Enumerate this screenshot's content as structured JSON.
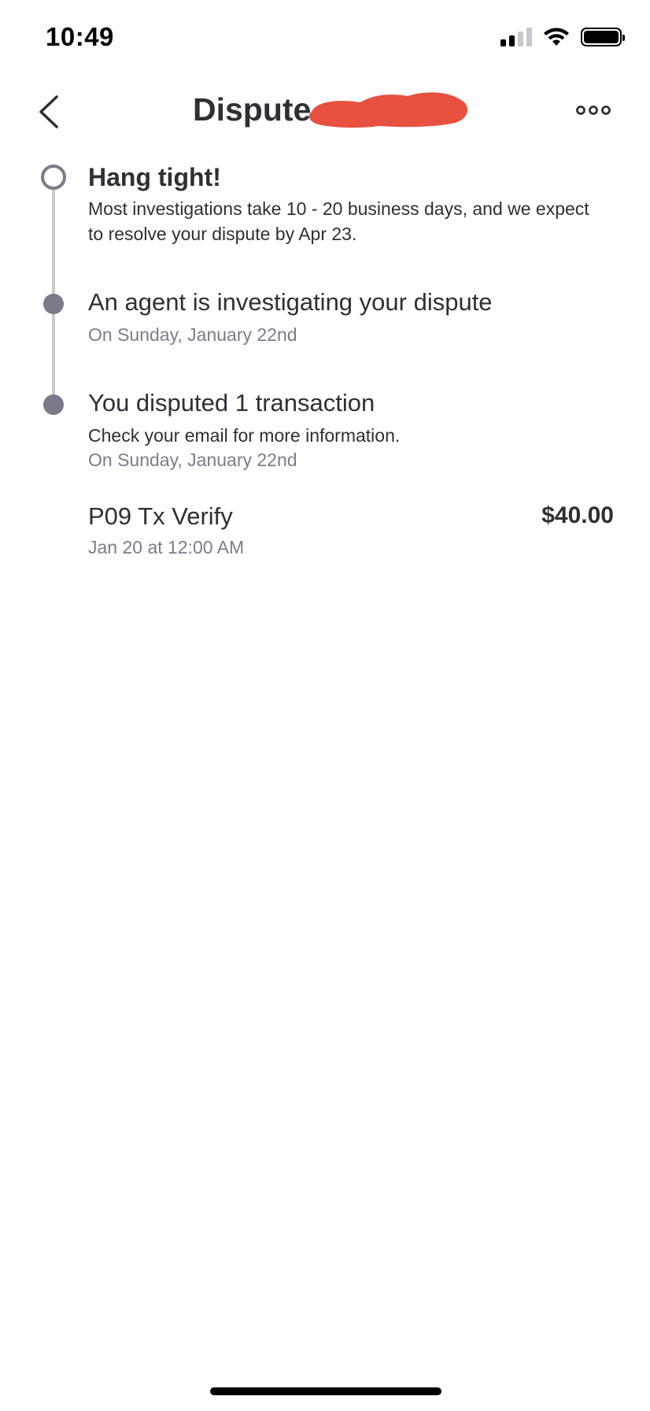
{
  "status_bar": {
    "time": "10:49",
    "icons": [
      "signal-icon",
      "wifi-icon",
      "battery-icon"
    ]
  },
  "nav": {
    "title": "Dispute",
    "back_icon": "chevron-left-icon",
    "more_icon": "more-horizontal-icon",
    "redaction_color": "#e8503f"
  },
  "timeline": {
    "current": {
      "title": "Hang tight!",
      "body_line1": "Most investigations take 10 - 20 business days, and we expect",
      "body_line2": "to resolve your dispute by Apr 23."
    },
    "events": [
      {
        "title": "An agent is investigating your dispute",
        "date": "On Sunday, January 22nd"
      },
      {
        "title": "You disputed 1 transaction",
        "detail": "Check your email for more information.",
        "date": "On Sunday, January 22nd"
      }
    ]
  },
  "transaction": {
    "name": "P09 Tx Verify",
    "amount": "$40.00",
    "date": "Jan 20 at 12:00 AM"
  },
  "colors": {
    "text": "#2f2f35",
    "muted": "#7c7c8c",
    "timeline_line": "#c9c9cc",
    "timeline_dot": "#7a7a8b"
  }
}
